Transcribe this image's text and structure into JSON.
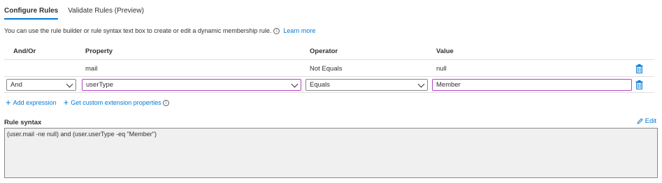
{
  "tabs": [
    {
      "label": "Configure Rules",
      "active": true
    },
    {
      "label": "Validate Rules (Preview)",
      "active": false
    }
  ],
  "description": {
    "text": "You can use the rule builder or rule syntax text box to create or edit a dynamic membership rule.",
    "info_icon": "info-icon",
    "learn_more": "Learn more"
  },
  "grid": {
    "headers": {
      "and_or": "And/Or",
      "property": "Property",
      "operator": "Operator",
      "value": "Value"
    },
    "row1": {
      "property": "mail",
      "operator": "Not Equals",
      "value": "null",
      "delete_icon": "trash-icon"
    },
    "row2": {
      "and_or": "And",
      "property": "userType",
      "operator": "Equals",
      "value": "Member",
      "delete_icon": "trash-icon"
    }
  },
  "actions": {
    "add_expression": "Add expression",
    "custom_extension": "Get custom extension properties"
  },
  "rule_syntax": {
    "label": "Rule syntax",
    "edit": "Edit",
    "value": "(user.mail -ne null) and (user.userType -eq \"Member\")"
  },
  "colors": {
    "accent": "#0078d4",
    "focus_border": "#b146c2",
    "syntax_bg": "#f0f0f0"
  }
}
